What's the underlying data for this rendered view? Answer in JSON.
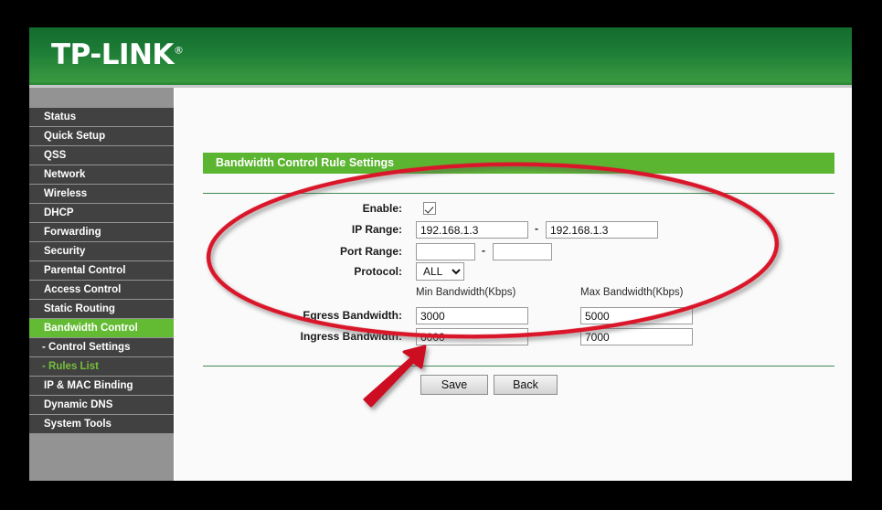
{
  "brand": {
    "name": "TP-LINK",
    "registered_mark": "®"
  },
  "sidebar": {
    "items": [
      {
        "label": "Status",
        "state": "normal"
      },
      {
        "label": "Quick Setup",
        "state": "normal"
      },
      {
        "label": "QSS",
        "state": "normal"
      },
      {
        "label": "Network",
        "state": "normal"
      },
      {
        "label": "Wireless",
        "state": "normal"
      },
      {
        "label": "DHCP",
        "state": "normal"
      },
      {
        "label": "Forwarding",
        "state": "normal"
      },
      {
        "label": "Security",
        "state": "normal"
      },
      {
        "label": "Parental Control",
        "state": "normal"
      },
      {
        "label": "Access Control",
        "state": "normal"
      },
      {
        "label": "Static Routing",
        "state": "normal"
      },
      {
        "label": "Bandwidth Control",
        "state": "active"
      },
      {
        "label": "- Control Settings",
        "state": "sub"
      },
      {
        "label": "- Rules List",
        "state": "sub-active"
      },
      {
        "label": "IP & MAC Binding",
        "state": "normal"
      },
      {
        "label": "Dynamic DNS",
        "state": "normal"
      },
      {
        "label": "System Tools",
        "state": "normal"
      }
    ]
  },
  "main": {
    "section_title": "Bandwidth Control Rule Settings",
    "labels": {
      "enable": "Enable:",
      "ip_range": "IP Range:",
      "port_range": "Port Range:",
      "protocol": "Protocol:",
      "egress": "Egress Bandwidth:",
      "ingress": "Ingress Bandwidth:",
      "min_bandwidth": "Min Bandwidth(Kbps)",
      "max_bandwidth": "Max Bandwidth(Kbps)",
      "dash": "-"
    },
    "values": {
      "enable_checked": true,
      "ip_start": "192.168.1.3",
      "ip_end": "192.168.1.3",
      "port_start": "",
      "port_end": "",
      "protocol_selected": "ALL",
      "protocol_options": [
        "ALL"
      ],
      "egress_min": "3000",
      "egress_max": "5000",
      "ingress_min": "6000",
      "ingress_max": "7000"
    },
    "placeholders": {
      "port_start": "",
      "port_end": ""
    },
    "buttons": {
      "save": "Save",
      "back": "Back"
    }
  },
  "annotations": {
    "ellipse_color": "#d9182c",
    "arrow_color": "#cc1122",
    "highlight_target": "bandwidth-rule-fields",
    "arrow_target": "save-button"
  },
  "colors": {
    "brand_green_dark": "#136c2e",
    "brand_green_light": "#3a9a41",
    "section_green": "#5cb531",
    "nav_background": "#414141",
    "nav_active": "#62bb32",
    "sub_active_text": "#76bf3a",
    "sidebar_filler": "#939393",
    "page_background": "#fafafa"
  }
}
